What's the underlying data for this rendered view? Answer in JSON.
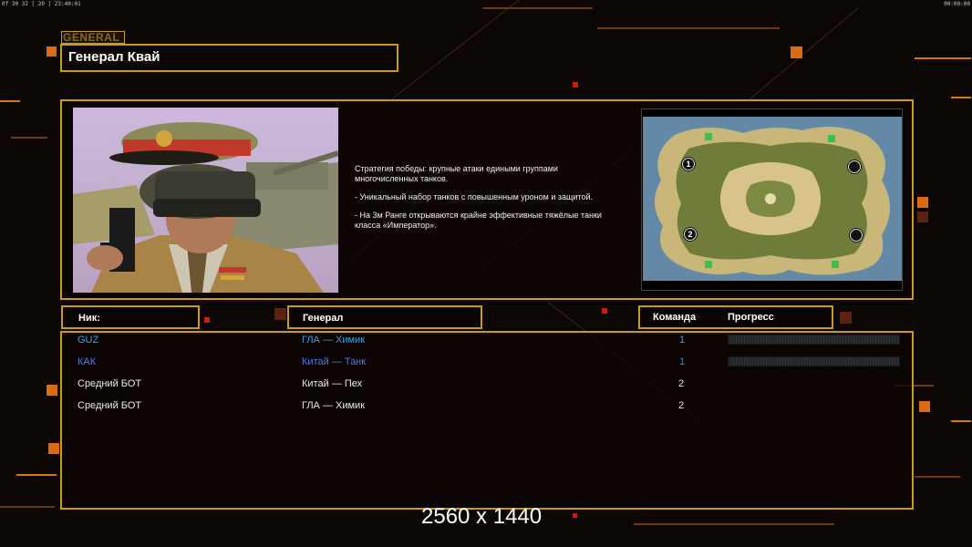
{
  "status_bar": {
    "left": "0f 30 32 [ 20 ] 23:40:01",
    "right": "00:00:00"
  },
  "general_tag": "GENERAL",
  "title": "Генерал Квай",
  "description": [
    "Стратегия победы: крупные атаки едиными группами\n многочисленных танков.",
    "- Уникальный набор танков с повышенным уроном и защитой.",
    "- На 3м Ранге открываются крайне эффективные тяжёлые танки\n класса «Император»."
  ],
  "map": {
    "start_positions": [
      "1",
      "2"
    ]
  },
  "columns": {
    "nick": "Ник:",
    "general": "Генерал",
    "team": "Команда",
    "progress": "Прогресс"
  },
  "players": [
    {
      "nick": "GUZ",
      "general": "ГЛА — Химик",
      "team": "1",
      "color": "#3aa0e0",
      "has_progress": true
    },
    {
      "nick": "КАК",
      "general": "Китай — Танк",
      "team": "1",
      "color": "#4a7ae8",
      "has_progress": true
    },
    {
      "nick": "Средний БОТ",
      "general": "Китай — Пех",
      "team": "2",
      "color": "#e8e8e8",
      "has_progress": false
    },
    {
      "nick": "Средний БОТ",
      "general": "ГЛА — Химик",
      "team": "2",
      "color": "#e8e8e8",
      "has_progress": false
    }
  ],
  "resolution_label": "2560 x 1440",
  "colors": {
    "frame": "#c99a1b",
    "accent_orange": "#e06a10",
    "background": "#0c0705"
  }
}
